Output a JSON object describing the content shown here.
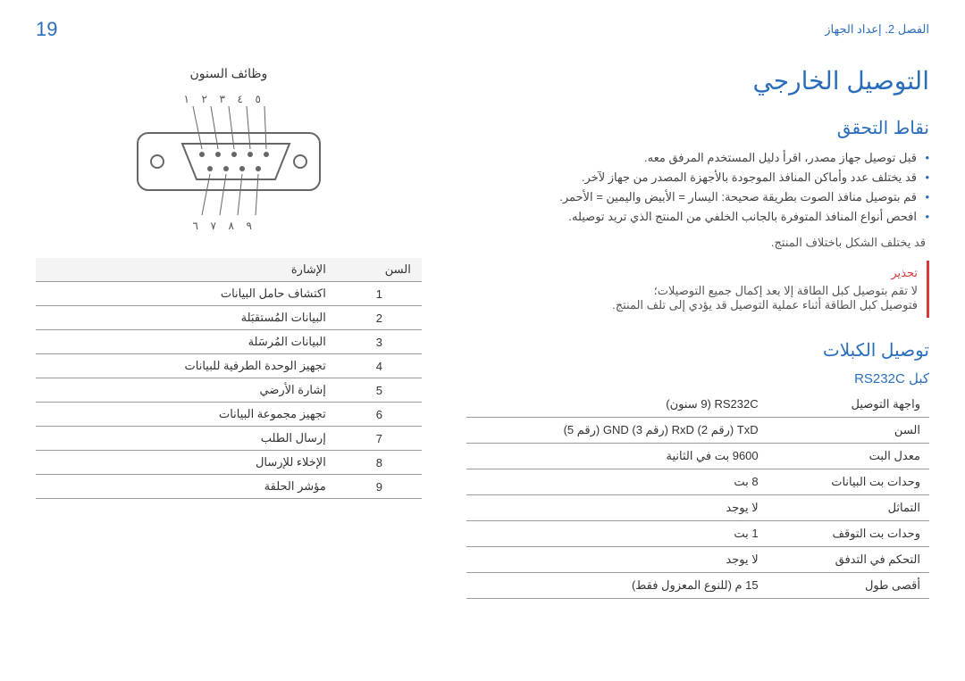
{
  "header": {
    "breadcrumb": "الفصل 2. إعداد الجهاز",
    "page_num": "19"
  },
  "main": {
    "title": "التوصيل الخارجي",
    "check_heading": "نقاط التحقق",
    "check_bullets": [
      "قبل توصيل جهاز مصدر، اقرأ دليل المستخدم المرفق معه.",
      "قد يختلف عدد وأماكن المنافذ الموجودة بالأجهزة المصدر من جهاز لآخر.",
      "قم بتوصيل منافذ الصوت بطريقة صحيحة: اليسار = الأبيض واليمين = الأحمر.",
      "افحص أنواع المنافذ المتوفرة بالجانب الخلفي من المنتج الذي تريد توصيله."
    ],
    "shape_note": "قد يختلف الشكل باختلاف المنتج.",
    "warn_title": "تحذير",
    "warn_lines": [
      "لا تقم بتوصيل كبل الطاقة إلا بعد إكمال جميع التوصيلات؛",
      "فتوصيل كبل الطاقة أثناء عملية التوصيل قد يؤدي إلى تلف المنتج."
    ],
    "cables_heading": "توصيل الكبلات",
    "cable_sub": "كبل RS232C",
    "cable_rows": [
      {
        "k": "واجهة التوصيل",
        "v": "RS232C (9 سنون)"
      },
      {
        "k": "السن",
        "v": "TxD (رقم 2) RxD (رقم 3) GND (رقم 5)"
      },
      {
        "k": "معدل البت",
        "v": "9600 بت في الثانية"
      },
      {
        "k": "وحدات بت البيانات",
        "v": "8 بت"
      },
      {
        "k": "التماثل",
        "v": "لا يوجد"
      },
      {
        "k": "وحدات بت التوقف",
        "v": "1 بت"
      },
      {
        "k": "التحكم في التدفق",
        "v": "لا يوجد"
      },
      {
        "k": "أقصى طول",
        "v": "15 م (للنوع المعزول فقط)"
      }
    ]
  },
  "pins": {
    "heading": "وظائف السنون",
    "th_pin": "السن",
    "th_sig": "الإشارة",
    "rows": [
      {
        "n": "1",
        "s": "اكتشاف حامل البيانات"
      },
      {
        "n": "2",
        "s": "البيانات المُستقبَلة"
      },
      {
        "n": "3",
        "s": "البيانات المُرسَلة"
      },
      {
        "n": "4",
        "s": "تجهيز الوحدة الطرفية للبيانات"
      },
      {
        "n": "5",
        "s": "إشارة الأرضي"
      },
      {
        "n": "6",
        "s": "تجهيز مجموعة البيانات"
      },
      {
        "n": "7",
        "s": "إرسال الطلب"
      },
      {
        "n": "8",
        "s": "الإخلاء للإرسال"
      },
      {
        "n": "9",
        "s": "مؤشر الحلقة"
      }
    ],
    "numerals_top": "١  ٢  ٣  ٤  ٥",
    "numerals_bot": "٦  ٧  ٨  ٩"
  }
}
